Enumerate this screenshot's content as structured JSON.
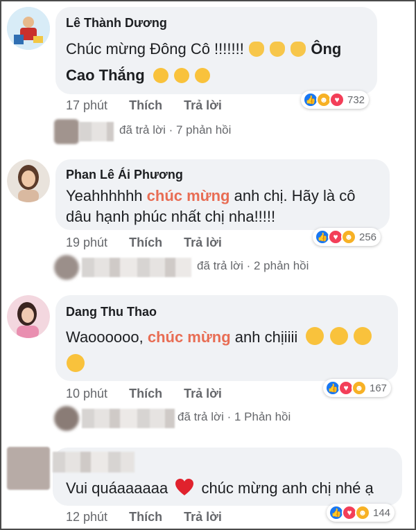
{
  "comments": [
    {
      "author": "Lê Thành Dương",
      "line1": "Chúc mừng Đông Cô !!!!!!! ",
      "line1_tail": "Ông",
      "line2": "Cao Thắng",
      "emoji_a": "clapping-hands",
      "emoji_b": "partying-face",
      "time": "17 phút",
      "like": "Thích",
      "reply": "Trả lời",
      "reaction_count": "732",
      "reactions": [
        "like",
        "haha",
        "love"
      ],
      "replies_text": "đã trả lời · 7 phản hồi"
    },
    {
      "author": "Phan Lê Ái Phương",
      "pre": "Yeahhhhhh ",
      "highlight": "chúc mừng",
      "post": " anh chị. Hãy là cô",
      "line2": "dâu hạnh phúc nhất chị nha!!!!!",
      "time": "19 phút",
      "like": "Thích",
      "reply": "Trả lời",
      "reaction_count": "256",
      "reactions": [
        "like",
        "love",
        "haha"
      ],
      "replies_text": "đã trả lời · 2 phản hồi"
    },
    {
      "author": "Dang Thu Thao",
      "pre": "Waoooooo, ",
      "highlight": "chúc mừng",
      "post": " anh chịiiii",
      "emoji": "heart-eyes",
      "time": "10 phút",
      "like": "Thích",
      "reply": "Trả lời",
      "reaction_count": "167",
      "reactions": [
        "like",
        "love",
        "haha"
      ],
      "replies_text": "đã trả lời · 1 Phản hồi"
    },
    {
      "pre": "Vui quáaaaaaa ",
      "post": " chúc mừng anh chị nhé ạ",
      "emoji": "red-heart",
      "time": "12 phút",
      "like": "Thích",
      "reply": "Trả lời",
      "reaction_count": "144",
      "reactions": [
        "like",
        "love",
        "haha"
      ]
    }
  ],
  "colors": {
    "bubble": "#f0f2f5",
    "highlight": "#e86d54",
    "like": "#1877f2",
    "love": "#f33e58",
    "haha": "#f7b125",
    "meta": "#65676b"
  }
}
